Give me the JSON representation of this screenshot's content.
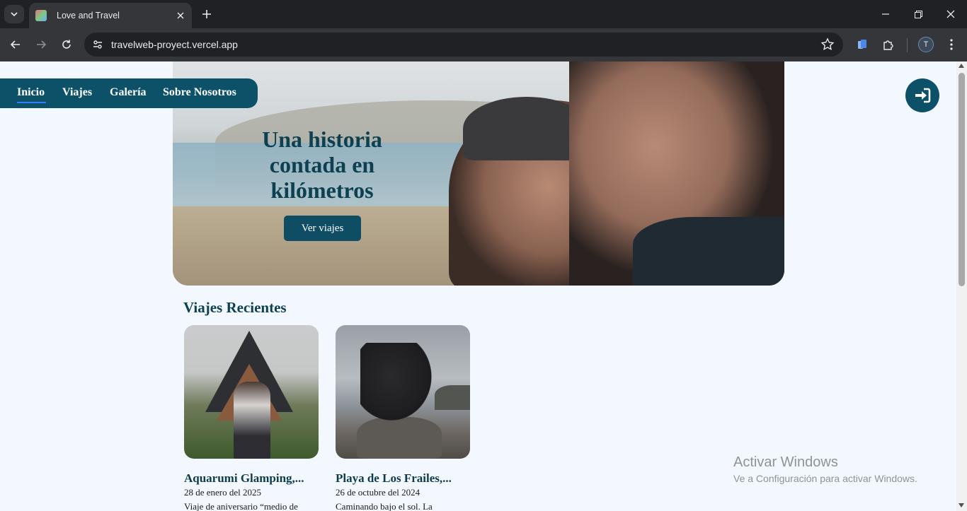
{
  "browser": {
    "tab": {
      "title": "Love and Travel"
    },
    "address_bar": {
      "url": "travelweb-proyect.vercel.app"
    },
    "profile_initial": "T"
  },
  "nav": {
    "items": [
      {
        "label": "Inicio",
        "active": true
      },
      {
        "label": "Viajes"
      },
      {
        "label": "Galería"
      },
      {
        "label": "Sobre Nosotros"
      }
    ]
  },
  "hero": {
    "title_lines": [
      "Una historia",
      "contada en",
      "kilómetros"
    ],
    "button_label": "Ver viajes"
  },
  "recent": {
    "heading": "Viajes Recientes",
    "cards": [
      {
        "title": "Aquarumi Glamping,...",
        "date": "28 de enero del 2025",
        "desc": "Viaje de aniversario “medio de"
      },
      {
        "title": "Playa de Los Frailes,...",
        "date": "26 de octubre del 2024",
        "desc": "Caminando bajo el sol. La"
      }
    ]
  },
  "watermark": {
    "title": "Activar Windows",
    "subtitle": "Ve a Configuración para activar Windows."
  },
  "colors": {
    "primary": "#0c5168",
    "text_dark": "#0d4152",
    "page_bg": "#f2f8fd",
    "active_underline": "#2f7cff"
  }
}
